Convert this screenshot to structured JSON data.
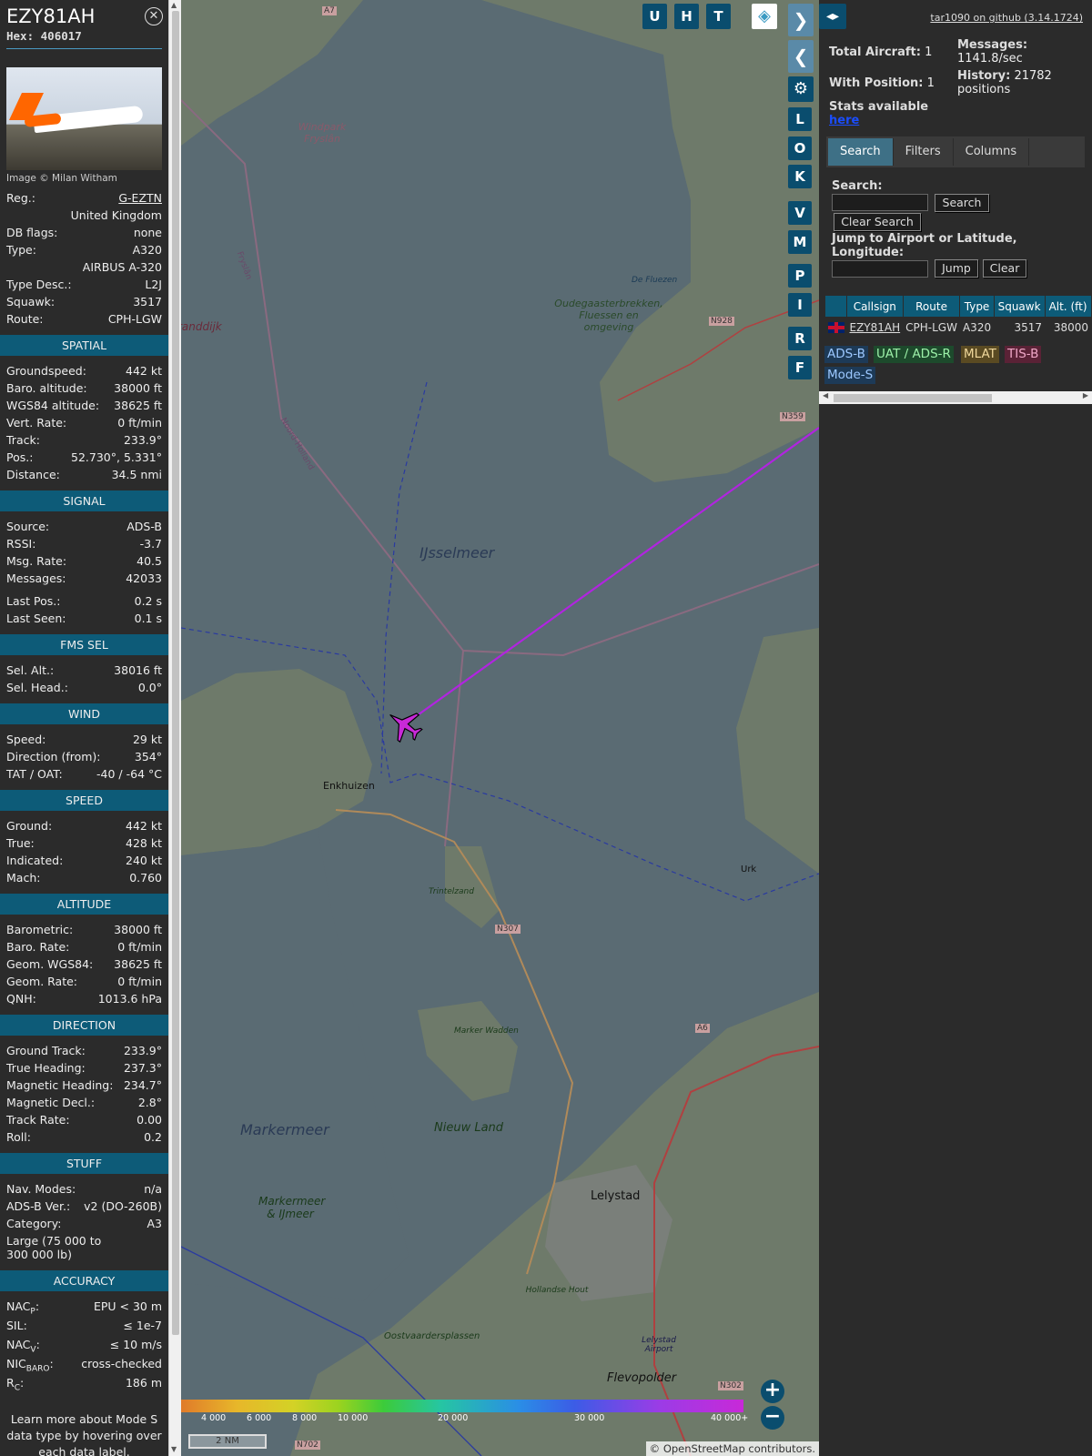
{
  "aircraft": {
    "callsign": "EZY81AH",
    "hex_label": "Hex:",
    "hex": "406017",
    "photo_credit": "Image © Milan Witham"
  },
  "info": [
    {
      "k": "Reg.:",
      "v": "G-EZTN"
    },
    {
      "k": "",
      "v": "United Kingdom"
    },
    {
      "k": "DB flags:",
      "v": "none"
    },
    {
      "k": "Type:",
      "v": "A320"
    },
    {
      "k": "",
      "v": "AIRBUS A-320"
    },
    {
      "k": "Type Desc.:",
      "v": "L2J"
    },
    {
      "k": "Squawk:",
      "v": "3517"
    },
    {
      "k": "Route:",
      "v": "CPH-LGW"
    }
  ],
  "sections": [
    {
      "title": "SPATIAL",
      "rows": [
        [
          "Groundspeed:",
          "442 kt"
        ],
        [
          "Baro. altitude:",
          "38000 ft"
        ],
        [
          "WGS84 altitude:",
          "38625 ft"
        ],
        [
          "Vert. Rate:",
          "0 ft/min"
        ],
        [
          "Track:",
          "233.9°"
        ],
        [
          "Pos.:",
          "52.730°, 5.331°"
        ],
        [
          "Distance:",
          "34.5 nmi"
        ]
      ]
    },
    {
      "title": "SIGNAL",
      "rows": [
        [
          "Source:",
          "ADS-B"
        ],
        [
          "RSSI:",
          "-3.7"
        ],
        [
          "Msg. Rate:",
          "40.5"
        ],
        [
          "Messages:",
          "42033"
        ],
        [
          "",
          ""
        ],
        [
          "Last Pos.:",
          "0.2 s"
        ],
        [
          "Last Seen:",
          "0.1 s"
        ]
      ]
    },
    {
      "title": "FMS SEL",
      "rows": [
        [
          "Sel. Alt.:",
          "38016 ft"
        ],
        [
          "Sel. Head.:",
          "0.0°"
        ]
      ]
    },
    {
      "title": "WIND",
      "rows": [
        [
          "Speed:",
          "29 kt"
        ],
        [
          "Direction (from):",
          "354°"
        ],
        [
          "TAT / OAT:",
          "-40 / -64 °C"
        ]
      ]
    },
    {
      "title": "SPEED",
      "rows": [
        [
          "Ground:",
          "442 kt"
        ],
        [
          "True:",
          "428 kt"
        ],
        [
          "Indicated:",
          "240 kt"
        ],
        [
          "Mach:",
          "0.760"
        ]
      ]
    },
    {
      "title": "ALTITUDE",
      "rows": [
        [
          "Barometric:",
          "38000 ft"
        ],
        [
          "Baro. Rate:",
          "0 ft/min"
        ],
        [
          "Geom. WGS84:",
          "38625 ft"
        ],
        [
          "Geom. Rate:",
          "0 ft/min"
        ],
        [
          "QNH:",
          "1013.6 hPa"
        ]
      ]
    },
    {
      "title": "DIRECTION",
      "rows": [
        [
          "Ground Track:",
          "233.9°"
        ],
        [
          "True Heading:",
          "237.3°"
        ],
        [
          "Magnetic Heading:",
          "234.7°"
        ],
        [
          "Magnetic Decl.:",
          "2.8°"
        ],
        [
          "Track Rate:",
          "0.00"
        ],
        [
          "Roll:",
          "0.2"
        ]
      ]
    },
    {
      "title": "STUFF",
      "rows": [
        [
          "Nav. Modes:",
          "n/a"
        ],
        [
          "ADS-B Ver.:",
          "v2 (DO-260B)"
        ],
        [
          "Category:",
          "A3"
        ]
      ]
    }
  ],
  "stuff_extra": "Large (75 000 to 300 000 lb)",
  "accuracy": {
    "title": "ACCURACY",
    "rows": [
      [
        "NAC",
        "P",
        ":",
        "EPU < 30 m"
      ],
      [
        "SIL:",
        "",
        "",
        "≤ 1e-7"
      ],
      [
        "NAC",
        "V",
        ":",
        "≤ 10 m/s"
      ],
      [
        "NIC",
        "BARO",
        ":",
        "cross-checked"
      ],
      [
        "R",
        "C",
        ":",
        "186 m"
      ]
    ]
  },
  "learn_more": "Learn more about Mode S data type by hovering over each data label.",
  "map": {
    "labels": [
      {
        "t": "Windpark Fryslân"
      },
      {
        "t": "IJsselmeer"
      },
      {
        "t": "Enkhuizen"
      },
      {
        "t": "Oudegaasterbrekken, Fluessen en omgeving"
      },
      {
        "t": "Trintelzand"
      },
      {
        "t": "Marker Wadden"
      },
      {
        "t": "Markermeer"
      },
      {
        "t": "Nieuw Land"
      },
      {
        "t": "Markermeer & IJmeer"
      },
      {
        "t": "Lelystad"
      },
      {
        "t": "Hollandse Hout"
      },
      {
        "t": "Oostvaardersplassen"
      },
      {
        "t": "Lelystad Airport"
      },
      {
        "t": "Flevopolder"
      },
      {
        "t": "Urk"
      },
      {
        "t": "De Fluezen"
      },
      {
        "t": "randdijk"
      },
      {
        "t": "Noord-Holland"
      },
      {
        "t": "Fryslân"
      },
      {
        "t": "N928"
      },
      {
        "t": "N359"
      },
      {
        "t": "N307"
      },
      {
        "t": "A6"
      },
      {
        "t": "N302"
      },
      {
        "t": "N702"
      },
      {
        "t": "A7"
      }
    ],
    "controls": [
      "U",
      "H",
      "T"
    ],
    "side_controls": [
      "L",
      "O",
      "K",
      "V",
      "M",
      "P",
      "I",
      "R",
      "F"
    ],
    "legend": [
      "4 000",
      "6 000",
      "8 000",
      "10 000",
      "20 000",
      "30 000",
      "40 000+"
    ],
    "scale": "2 NM",
    "attribution": "© OpenStreetMap contributors.",
    "track_color": "#b124e0"
  },
  "panel": {
    "github": "tar1090 on github (3.14.1724)",
    "total_label": "Total Aircraft:",
    "total": "1",
    "withpos_label": "With Position:",
    "withpos": "1",
    "messages_label": "Messages:",
    "messages": "1141.8/sec",
    "history_label": "History:",
    "history": "21782 positions",
    "stats": "Stats available",
    "stats_link": "here",
    "tabs": [
      "Search",
      "Filters",
      "Columns"
    ],
    "search_label": "Search:",
    "search_btn": "Search",
    "clear_search": "Clear Search",
    "jump_label": "Jump to Airport or Latitude, Longitude:",
    "jump_btn": "Jump",
    "clear_btn": "Clear",
    "columns": [
      "Callsign",
      "Route",
      "Type",
      "Squawk",
      "Alt. (ft)"
    ],
    "row": {
      "callsign": "EZY81AH",
      "route": "CPH-LGW",
      "type": "A320",
      "squawk": "3517",
      "alt": "38000"
    },
    "badges": [
      {
        "t": "ADS-B",
        "c": "#1d3a57"
      },
      {
        "t": "UAT / ADS-R",
        "c": "#1d4a2c"
      },
      {
        "t": "MLAT",
        "c": "#5a4a22"
      },
      {
        "t": "TIS-B",
        "c": "#5a2236"
      },
      {
        "t": "Mode-S",
        "c": "#1d3a57"
      }
    ]
  }
}
